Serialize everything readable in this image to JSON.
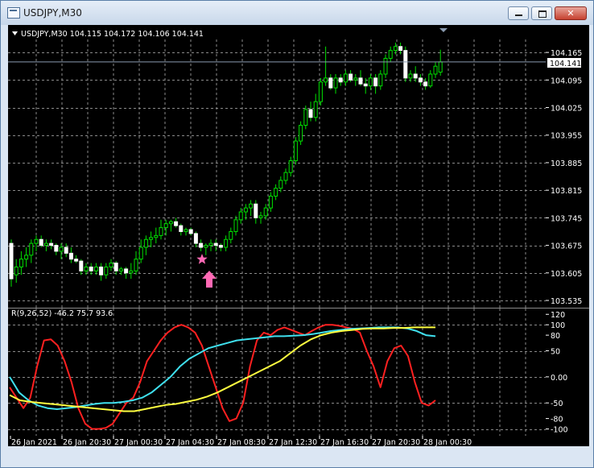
{
  "window": {
    "title": "USDJPY,M30",
    "minimize_glyph": "",
    "maximize_glyph": "",
    "close_glyph": "✕"
  },
  "icons": {
    "app": "chart-window-icon",
    "dropdown": "triangle-down-icon",
    "star": "star-marker-icon",
    "arrow": "up-arrow-marker-icon",
    "scroll": "chart-shift-triangle-icon"
  },
  "colors": {
    "background": "#000000",
    "grid": "#8a8a8a",
    "text": "#ffffff",
    "candle_bull": "#00e000",
    "candle_bear": "#ffffff",
    "price_line": "#8a9bb0",
    "marker": "#ff69b4",
    "series_red": "#ff2020",
    "series_cyan": "#3fe0ee",
    "series_yellow": "#ffff40"
  },
  "main_panel": {
    "symbol_header": "USDJPY,M30  104.115 104.172 104.106 104.141",
    "current_price": "104.141",
    "price_ticks": [
      "104.165",
      "104.095",
      "104.025",
      "103.955",
      "103.885",
      "103.815",
      "103.745",
      "103.675",
      "103.605",
      "103.535"
    ]
  },
  "indicator_panel": {
    "header": "R(9,26,52) -46.2 75.7 93.6",
    "ticks": [
      "120",
      "100",
      "80",
      "50",
      "0.00",
      "-50",
      "-80",
      "-100"
    ]
  },
  "time_axis": {
    "labels": [
      "26 Jan 2021",
      "26 Jan 20:30",
      "27 Jan 00:30",
      "27 Jan 04:30",
      "27 Jan 08:30",
      "27 Jan 12:30",
      "27 Jan 16:30",
      "27 Jan 20:30",
      "28 Jan 00:30"
    ]
  },
  "chart_data": [
    {
      "type": "candlestick",
      "price_range": [
        103.535,
        104.2
      ],
      "ohlc": [
        [
          103.68,
          103.69,
          103.57,
          103.59
        ],
        [
          103.6,
          103.64,
          103.58,
          103.62
        ],
        [
          103.62,
          103.66,
          103.6,
          103.64
        ],
        [
          103.64,
          103.67,
          103.62,
          103.65
        ],
        [
          103.65,
          103.69,
          103.63,
          103.68
        ],
        [
          103.68,
          103.7,
          103.66,
          103.69
        ],
        [
          103.69,
          103.7,
          103.67,
          103.675
        ],
        [
          103.675,
          103.69,
          103.66,
          103.68
        ],
        [
          103.68,
          103.69,
          103.665,
          103.675
        ],
        [
          103.675,
          103.68,
          103.65,
          103.66
        ],
        [
          103.66,
          103.68,
          103.64,
          103.67
        ],
        [
          103.67,
          103.68,
          103.645,
          103.655
        ],
        [
          103.655,
          103.67,
          103.63,
          103.64
        ],
        [
          103.64,
          103.65,
          103.63,
          103.635
        ],
        [
          103.635,
          103.64,
          103.6,
          103.61
        ],
        [
          103.61,
          103.63,
          103.6,
          103.62
        ],
        [
          103.62,
          103.63,
          103.6,
          103.61
        ],
        [
          103.61,
          103.63,
          103.6,
          103.62
        ],
        [
          103.62,
          103.63,
          103.585,
          103.6
        ],
        [
          103.6,
          103.63,
          103.59,
          103.62
        ],
        [
          103.62,
          103.64,
          103.61,
          103.63
        ],
        [
          103.63,
          103.635,
          103.6,
          103.61
        ],
        [
          103.61,
          103.62,
          103.6,
          103.615
        ],
        [
          103.615,
          103.62,
          103.59,
          103.605
        ],
        [
          103.605,
          103.63,
          103.59,
          103.61
        ],
        [
          103.61,
          103.66,
          103.6,
          103.64
        ],
        [
          103.64,
          103.69,
          103.63,
          103.67
        ],
        [
          103.67,
          103.7,
          103.65,
          103.69
        ],
        [
          103.69,
          103.71,
          103.67,
          103.695
        ],
        [
          103.695,
          103.72,
          103.68,
          103.7
        ],
        [
          103.7,
          103.74,
          103.69,
          103.72
        ],
        [
          103.72,
          103.74,
          103.7,
          103.73
        ],
        [
          103.73,
          103.74,
          103.71,
          103.735
        ],
        [
          103.735,
          103.745,
          103.72,
          103.725
        ],
        [
          103.725,
          103.73,
          103.7,
          103.71
        ],
        [
          103.71,
          103.72,
          103.7,
          103.715
        ],
        [
          103.715,
          103.72,
          103.7,
          103.705
        ],
        [
          103.705,
          103.71,
          103.67,
          103.68
        ],
        [
          103.68,
          103.69,
          103.66,
          103.67
        ],
        [
          103.67,
          103.68,
          103.65,
          103.675
        ],
        [
          103.675,
          103.69,
          103.66,
          103.68
        ],
        [
          103.68,
          103.69,
          103.66,
          103.675
        ],
        [
          103.675,
          103.68,
          103.66,
          103.67
        ],
        [
          103.67,
          103.7,
          103.66,
          103.69
        ],
        [
          103.69,
          103.72,
          103.68,
          103.71
        ],
        [
          103.71,
          103.75,
          103.7,
          103.74
        ],
        [
          103.74,
          103.77,
          103.73,
          103.76
        ],
        [
          103.76,
          103.78,
          103.74,
          103.77
        ],
        [
          103.77,
          103.79,
          103.75,
          103.78
        ],
        [
          103.78,
          103.79,
          103.73,
          103.745
        ],
        [
          103.745,
          103.76,
          103.73,
          103.75
        ],
        [
          103.75,
          103.78,
          103.74,
          103.77
        ],
        [
          103.77,
          103.81,
          103.76,
          103.8
        ],
        [
          103.8,
          103.83,
          103.79,
          103.82
        ],
        [
          103.82,
          103.85,
          103.81,
          103.84
        ],
        [
          103.84,
          103.87,
          103.83,
          103.86
        ],
        [
          103.86,
          103.9,
          103.85,
          103.89
        ],
        [
          103.89,
          103.95,
          103.88,
          103.94
        ],
        [
          103.94,
          103.99,
          103.93,
          103.98
        ],
        [
          103.98,
          104.03,
          103.97,
          104.02
        ],
        [
          104.02,
          104.04,
          103.99,
          104.0
        ],
        [
          104.0,
          104.06,
          103.99,
          104.04
        ],
        [
          104.04,
          104.1,
          104.03,
          104.09
        ],
        [
          104.09,
          104.18,
          104.08,
          104.1
        ],
        [
          104.1,
          104.11,
          104.07,
          104.075
        ],
        [
          104.075,
          104.11,
          104.06,
          104.1
        ],
        [
          104.1,
          104.11,
          104.08,
          104.09
        ],
        [
          104.09,
          104.12,
          104.08,
          104.11
        ],
        [
          104.11,
          104.12,
          104.09,
          104.095
        ],
        [
          104.095,
          104.11,
          104.08,
          104.1
        ],
        [
          104.1,
          104.12,
          104.08,
          104.085
        ],
        [
          104.085,
          104.1,
          104.06,
          104.08
        ],
        [
          104.08,
          104.11,
          104.07,
          104.1
        ],
        [
          104.1,
          104.11,
          104.06,
          104.08
        ],
        [
          104.08,
          104.12,
          104.07,
          104.11
        ],
        [
          104.11,
          104.16,
          104.1,
          104.15
        ],
        [
          104.15,
          104.18,
          104.14,
          104.17
        ],
        [
          104.17,
          104.19,
          104.16,
          104.18
        ],
        [
          104.18,
          104.19,
          104.16,
          104.17
        ],
        [
          104.17,
          104.18,
          104.09,
          104.1
        ],
        [
          104.1,
          104.12,
          104.09,
          104.11
        ],
        [
          104.11,
          104.13,
          104.09,
          104.1
        ],
        [
          104.1,
          104.11,
          104.08,
          104.09
        ],
        [
          104.09,
          104.1,
          104.07,
          104.08
        ],
        [
          104.08,
          104.12,
          104.075,
          104.11
        ],
        [
          104.11,
          104.14,
          104.1,
          104.13
        ],
        [
          104.115,
          104.172,
          104.106,
          104.141
        ]
      ]
    },
    {
      "type": "line",
      "ylim": [
        -110,
        125
      ],
      "series": [
        {
          "color": "#ff2020",
          "values": [
            -20,
            -40,
            -60,
            -40,
            20,
            70,
            72,
            60,
            30,
            -10,
            -60,
            -90,
            -100,
            -100,
            -98,
            -90,
            -70,
            -50,
            -40,
            -10,
            30,
            50,
            70,
            85,
            95,
            100,
            95,
            85,
            60,
            20,
            -20,
            -60,
            -85,
            -80,
            -50,
            20,
            70,
            85,
            80,
            90,
            95,
            90,
            85,
            80,
            88,
            95,
            100,
            100,
            98,
            95,
            92,
            85,
            50,
            20,
            -20,
            30,
            55,
            60,
            40,
            -10,
            -50,
            -55,
            -45
          ]
        },
        {
          "color": "#3fe0ee",
          "values": [
            0,
            -30,
            -45,
            -55,
            -60,
            -62,
            -60,
            -58,
            -55,
            -52,
            -50,
            -50,
            -48,
            -45,
            -40,
            -30,
            -15,
            0,
            20,
            35,
            45,
            55,
            60,
            65,
            70,
            72,
            74,
            76,
            78,
            78,
            79,
            80,
            82,
            85,
            88,
            90,
            92,
            93,
            94,
            95,
            95,
            95,
            93,
            88,
            80,
            78
          ]
        },
        {
          "color": "#ffff40",
          "values": [
            -35,
            -45,
            -48,
            -50,
            -52,
            -54,
            -56,
            -58,
            -60,
            -62,
            -64,
            -66,
            -66,
            -62,
            -58,
            -54,
            -52,
            -48,
            -44,
            -38,
            -30,
            -20,
            -10,
            0,
            10,
            20,
            30,
            45,
            60,
            72,
            80,
            85,
            88,
            90,
            92,
            93,
            93,
            94,
            94,
            95,
            95,
            95
          ]
        }
      ]
    }
  ]
}
